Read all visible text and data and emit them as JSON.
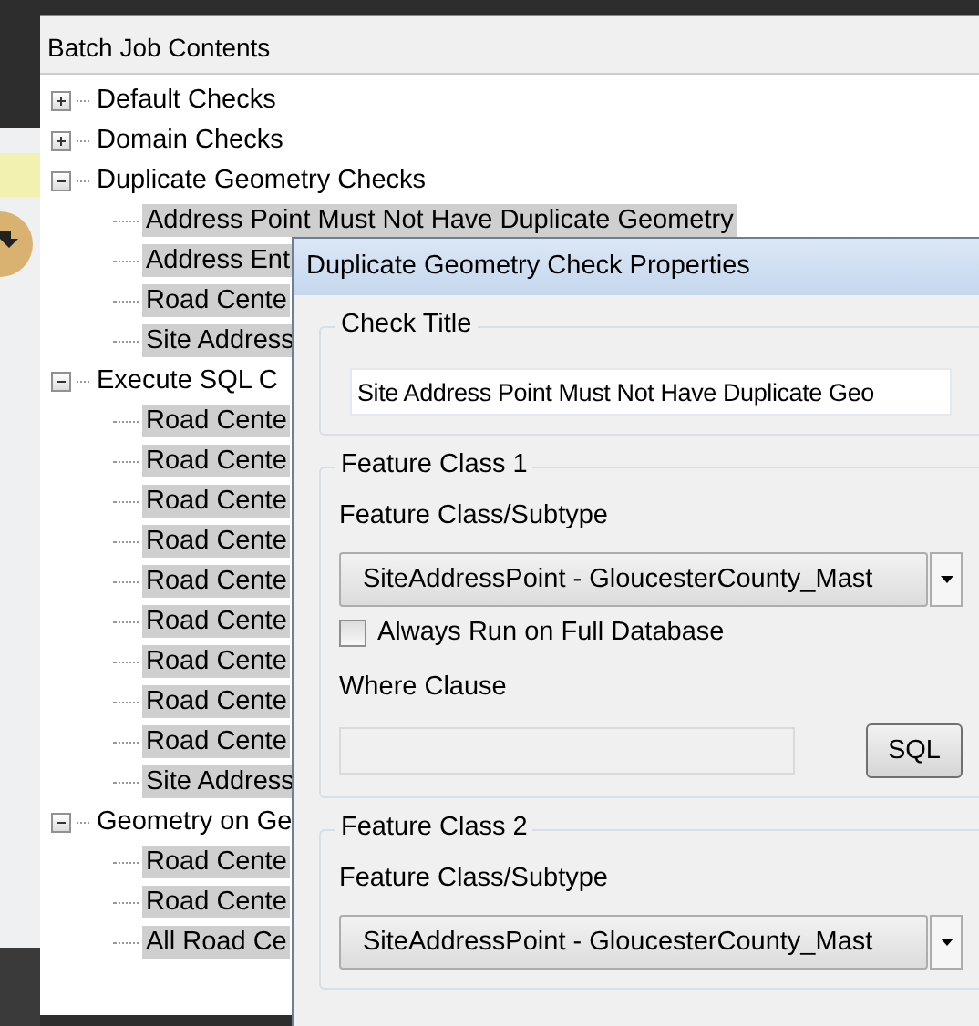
{
  "panel": {
    "title": "Batch Job Contents"
  },
  "tree": [
    {
      "label": "Default Checks",
      "expanded": false,
      "selected": false
    },
    {
      "label": "Domain Checks",
      "expanded": false,
      "selected": false
    },
    {
      "label": "Duplicate Geometry Checks",
      "expanded": true,
      "selected": false,
      "children": [
        {
          "label": "Address Point Must Not Have Duplicate Geometry",
          "selected": true
        },
        {
          "label": "Address Ent",
          "selected": true
        },
        {
          "label": "Road Cente",
          "selected": true
        },
        {
          "label": "Site Address",
          "selected": true
        }
      ]
    },
    {
      "label": "Execute SQL C",
      "expanded": true,
      "selected": false,
      "children": [
        {
          "label": "Road Cente",
          "selected": true
        },
        {
          "label": "Road Cente",
          "selected": true
        },
        {
          "label": "Road Cente",
          "selected": true
        },
        {
          "label": "Road Cente",
          "selected": true
        },
        {
          "label": "Road Cente",
          "selected": true
        },
        {
          "label": "Road Cente",
          "selected": true
        },
        {
          "label": "Road Cente",
          "selected": true
        },
        {
          "label": "Road Cente",
          "selected": true
        },
        {
          "label": "Road Cente",
          "selected": true
        },
        {
          "label": "Site Address",
          "selected": true
        }
      ]
    },
    {
      "label": "Geometry on Ge",
      "expanded": true,
      "selected": false,
      "children": [
        {
          "label": "Road Cente",
          "selected": true
        },
        {
          "label": "Road Cente",
          "selected": true
        },
        {
          "label": "All Road Ce",
          "selected": true
        }
      ]
    }
  ],
  "dialog": {
    "title": "Duplicate Geometry Check Properties",
    "check_title": {
      "legend": "Check Title",
      "value": "Site Address Point Must Not Have Duplicate Geo"
    },
    "feature_class_1": {
      "legend": "Feature Class 1",
      "label": "Feature Class/Subtype",
      "value": "SiteAddressPoint -  GloucesterCounty_Mast",
      "checkbox": {
        "label": "Always Run on Full Database",
        "checked": false
      },
      "where_label": "Where Clause",
      "where_disabled": true,
      "sql_button": "SQL"
    },
    "feature_class_2": {
      "legend": "Feature Class 2",
      "label": "Feature Class/Subtype",
      "value": "SiteAddressPoint -  GloucesterCounty_Mast"
    }
  }
}
